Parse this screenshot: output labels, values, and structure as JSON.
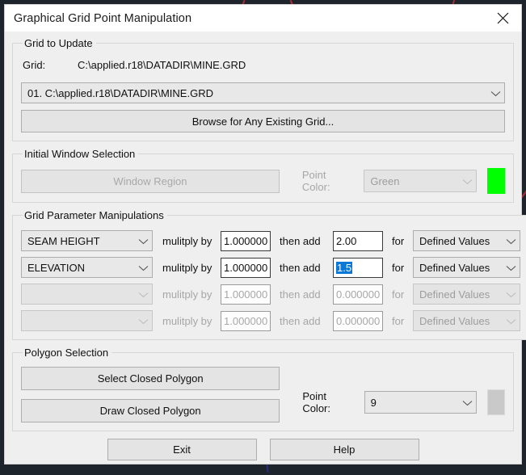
{
  "window": {
    "title": "Graphical Grid Point Manipulation",
    "close_icon": "close-icon"
  },
  "grid_to_update": {
    "legend": "Grid to Update",
    "grid_label": "Grid:",
    "grid_path": "C:\\applied.r18\\DATADIR\\MINE.GRD",
    "grid_combo_value": "01. C:\\applied.r18\\DATADIR\\MINE.GRD",
    "browse_button": "Browse for Any Existing Grid..."
  },
  "initial_window_selection": {
    "legend": "Initial Window Selection",
    "window_region_button": "Window Region",
    "point_color_label": "Point Color:",
    "point_color_value": "Green",
    "swatch_color": "#00ff00"
  },
  "grid_parameter_manipulations": {
    "legend": "Grid Parameter Manipulations",
    "multiply_label": "mulitply by",
    "then_add_label": "then add",
    "for_label": "for",
    "rows": [
      {
        "parameter": "SEAM HEIGHT",
        "multiply": "1.000000",
        "add": "2.00",
        "add_selected": false,
        "scope": "Defined Values",
        "enabled": true
      },
      {
        "parameter": "ELEVATION",
        "multiply": "1.000000",
        "add": "1.5",
        "add_selected": true,
        "scope": "Defined Values",
        "enabled": true
      },
      {
        "parameter": "",
        "multiply": "1.000000",
        "add": "0.000000",
        "add_selected": false,
        "scope": "Defined Values",
        "enabled": false
      },
      {
        "parameter": "",
        "multiply": "1.000000",
        "add": "0.000000",
        "add_selected": false,
        "scope": "Defined Values",
        "enabled": false
      }
    ]
  },
  "polygon_selection": {
    "legend": "Polygon Selection",
    "select_button": "Select Closed Polygon",
    "draw_button": "Draw Closed Polygon",
    "point_color_label": "Point Color:",
    "point_color_value": "9"
  },
  "footer": {
    "exit_button": "Exit",
    "help_button": "Help"
  }
}
